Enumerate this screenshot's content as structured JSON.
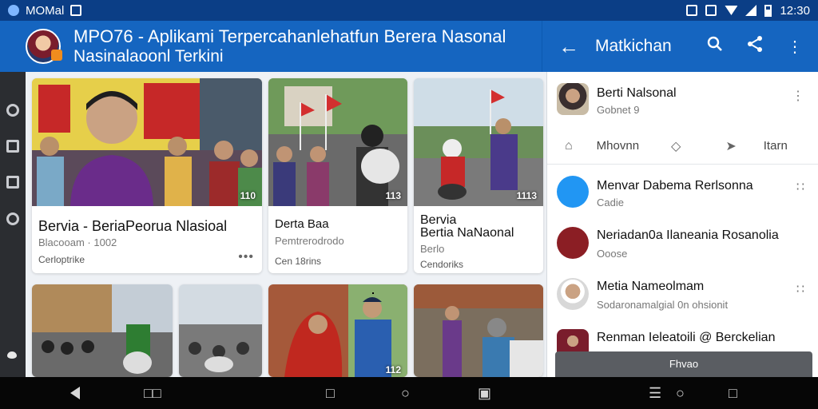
{
  "status_bar": {
    "carrier": "MOMal",
    "time": "12:30"
  },
  "app_bar": {
    "title_line1": "MPO76 - Aplikami Terpercahanlehatfun Berera Nasonal",
    "title_line2": "Nasinalaoonl Terkini",
    "panel_title": "Matkichan"
  },
  "cards": [
    {
      "count": "110",
      "title": "Bervia - BeriaPeorua Nlasioal",
      "sub": "Blacooam · 1002",
      "meta": "Cerloptrike"
    },
    {
      "count": "113",
      "title": "Derta Baa",
      "sub": "Pemtrerodrodo",
      "meta": "Cen 18rins"
    },
    {
      "count": "1113",
      "title": "Bervia\nBertia NaNaonal",
      "sub": "Berlo",
      "meta": "Cendoriks"
    },
    {
      "count": ""
    },
    {
      "count": ""
    },
    {
      "count": "112"
    },
    {
      "count": ""
    }
  ],
  "panel": {
    "top_item": {
      "title": "Berti Nalsonal",
      "sub": "Gobnet 9"
    },
    "actions": [
      "Mhovnn",
      "",
      "Itarn"
    ],
    "items": [
      {
        "title": "Menvar Dabema Rerlsonna",
        "sub": "Cadie"
      },
      {
        "title": "Neriadan0a Ilaneania Rosanolia",
        "sub": "Ooose"
      },
      {
        "title": "Metia Nameolmam",
        "sub": "Sodaronamalgial 0n ohsionit"
      },
      {
        "title": "Renman Ieleatoili @ Berckelian",
        "sub": ""
      }
    ],
    "refresh_label": "Fhvao"
  },
  "colors": {
    "status_bar": "#0b3e86",
    "app_bar": "#1565c0",
    "nav_bar": "#060606"
  }
}
